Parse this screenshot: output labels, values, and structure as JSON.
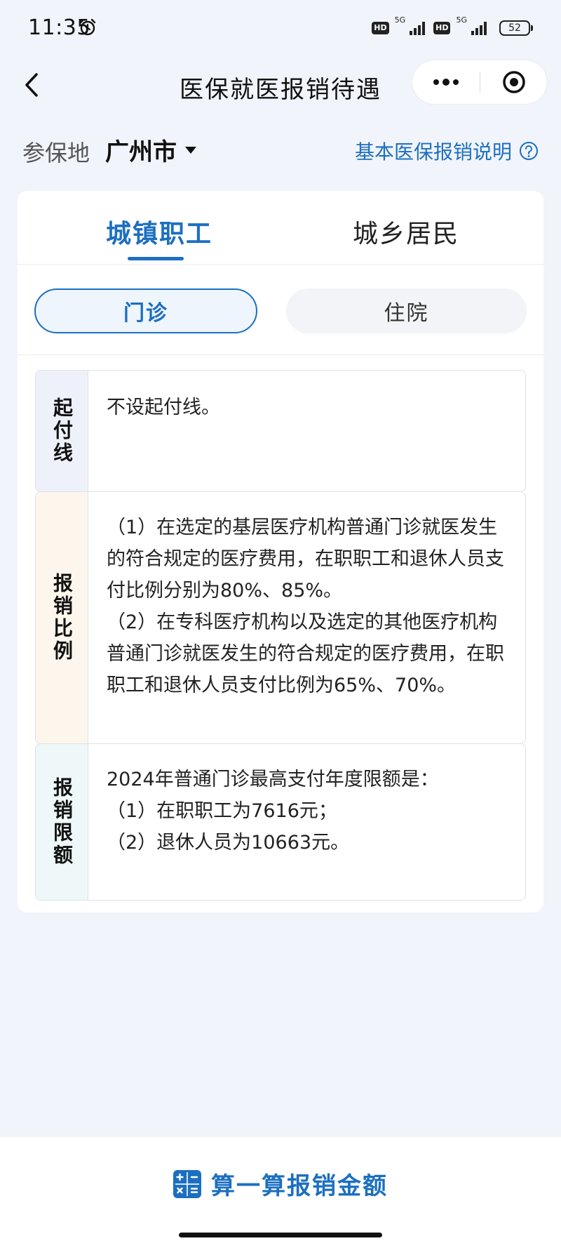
{
  "status_bar": {
    "time": "11:35",
    "sim1_badge": "HD",
    "sim1_network": "5G",
    "sim2_badge": "HD",
    "sim2_network": "5G",
    "battery": "52"
  },
  "nav": {
    "title": "医保就医报销待遇",
    "more_icon": "more-dots-icon",
    "close_icon": "target-close-icon"
  },
  "location": {
    "label": "参保地",
    "city": "广州市",
    "help_text": "基本医保报销说明",
    "help_icon": "question-circle-icon"
  },
  "tabs": {
    "items": [
      {
        "label": "城镇职工",
        "active": true
      },
      {
        "label": "城乡居民",
        "active": false
      }
    ]
  },
  "segments": {
    "items": [
      {
        "label": "门诊",
        "active": true
      },
      {
        "label": "住院",
        "active": false
      }
    ]
  },
  "info": {
    "rows": [
      {
        "label": "起付线",
        "paragraphs": [
          "不设起付线。"
        ]
      },
      {
        "label": "报销比例",
        "paragraphs": [
          "（1）在选定的基层医疗机构普通门诊就医发生的符合规定的医疗费用，在职职工和退休人员支付比例分别为80%、85%。",
          "（2）在专科医疗机构以及选定的其他医疗机构普通门诊就医发生的符合规定的医疗费用，在职职工和退休人员支付比例为65%、70%。"
        ]
      },
      {
        "label": "报销限额",
        "paragraphs": [
          "2024年普通门诊最高支付年度限额是：",
          "（1）在职职工为7616元；",
          "（2）退休人员为10663元。"
        ]
      }
    ]
  },
  "bottom": {
    "button_label": "算一算报销金额",
    "button_icon": "calculator-icon"
  },
  "colors": {
    "accent": "#1c6fc0",
    "background": "#f1f4fa"
  }
}
